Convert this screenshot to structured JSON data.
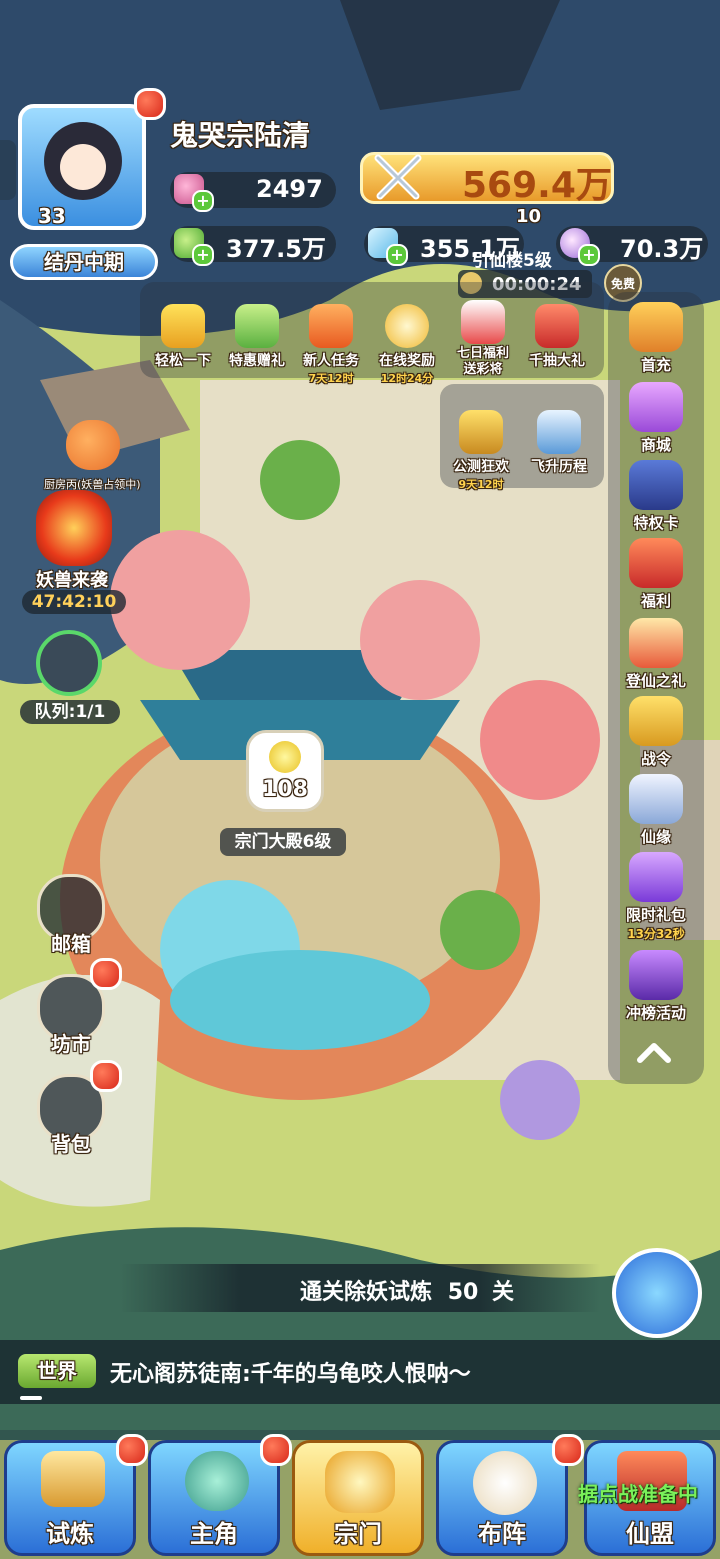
{
  "player": {
    "name": "鬼哭宗陆清",
    "level": "33",
    "realm": "结丹中期"
  },
  "resources": {
    "peach": "2497",
    "jade": "377.5万",
    "power": "569.4万",
    "crystal": "355.1万",
    "gem": "70.3万"
  },
  "building_top": {
    "badge": "10",
    "name": "引仙楼5级",
    "timer": "00:00:24",
    "free_tag": "免费"
  },
  "top_activities": [
    {
      "icon": "gamepad-icon",
      "label": "轻松一下",
      "sub": ""
    },
    {
      "icon": "gift-bag-icon",
      "label": "特惠赠礼",
      "sub": ""
    },
    {
      "icon": "scroll-icon",
      "label": "新人任务",
      "sub": "7天12时"
    },
    {
      "icon": "clock-icon",
      "label": "在线奖励",
      "sub": "12时24分"
    },
    {
      "icon": "calendar-icon",
      "label": "七日福利\n送彩将",
      "sub": ""
    },
    {
      "icon": "gift-box-icon",
      "label": "千抽大礼",
      "sub": ""
    }
  ],
  "mid_activities": [
    {
      "icon": "treasure-icon",
      "label": "公测狂欢",
      "sub": "9天12时"
    },
    {
      "icon": "mountain-icon",
      "label": "飞升历程",
      "sub": ""
    }
  ],
  "right_menu": [
    {
      "icon": "first-charge-icon",
      "label": "首充",
      "sub": ""
    },
    {
      "icon": "shop-icon",
      "label": "商城",
      "sub": ""
    },
    {
      "icon": "privilege-card-icon",
      "label": "特权卡",
      "sub": ""
    },
    {
      "icon": "welfare-bag-icon",
      "label": "福利",
      "sub": ""
    },
    {
      "icon": "ascension-gift-icon",
      "label": "登仙之礼",
      "sub": ""
    },
    {
      "icon": "battle-pass-icon",
      "label": "战令",
      "sub": ""
    },
    {
      "icon": "immortal-fate-icon",
      "label": "仙缘",
      "sub": ""
    },
    {
      "icon": "limited-pack-icon",
      "label": "限时礼包",
      "sub": "13分32秒"
    },
    {
      "icon": "ranking-icon",
      "label": "冲榜活动",
      "sub": ""
    }
  ],
  "left_events": {
    "kitchen_label": "厨房丙(妖兽占领中)",
    "beast_label": "妖兽来袭",
    "beast_timer": "47:42:10",
    "queue_label": "队列:1/1"
  },
  "main_building": {
    "count": "108",
    "name": "宗门大殿6级"
  },
  "left_menu": [
    {
      "icon": "mail-icon",
      "label": "邮箱"
    },
    {
      "icon": "market-icon",
      "label": "坊市"
    },
    {
      "icon": "bag-icon",
      "label": "背包"
    }
  ],
  "quest": {
    "text": "通关除妖试炼",
    "count": "50",
    "unit": "关"
  },
  "chat": {
    "channel": "世界",
    "message": "无心阁苏徒南:千年的乌龟咬人恨呐～"
  },
  "bottom_nav": [
    {
      "icon": "trial-icon",
      "label": "试炼"
    },
    {
      "icon": "hero-icon",
      "label": "主角"
    },
    {
      "icon": "sect-icon",
      "label": "宗门"
    },
    {
      "icon": "formation-icon",
      "label": "布阵"
    },
    {
      "icon": "alliance-icon",
      "label": "仙盟"
    }
  ],
  "alliance_tip": "据点战准备中",
  "colors": {
    "accent_gold": "#f2c14a",
    "nav_blue": "#2b6fd6",
    "red_dot": "#d8281a",
    "grass": "#c9d77a"
  }
}
